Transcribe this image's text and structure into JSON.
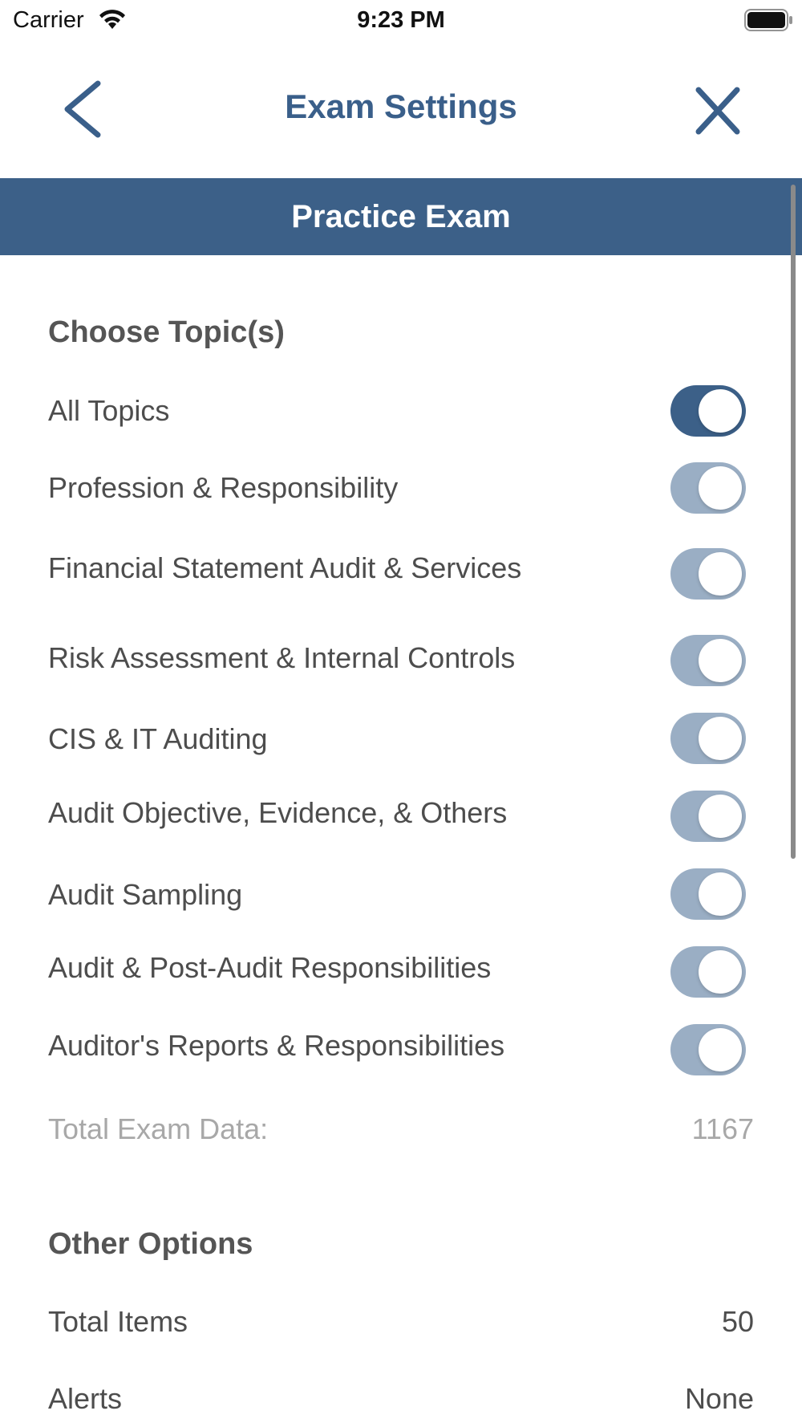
{
  "status_bar": {
    "carrier": "Carrier",
    "time": "9:23 PM",
    "icons": [
      "wifi-icon",
      "battery-icon"
    ]
  },
  "nav": {
    "title": "Exam Settings",
    "back_icon": "chevron-left-icon",
    "close_icon": "close-icon",
    "accent_color": "#3a5f8a"
  },
  "banner": {
    "title": "Practice Exam",
    "background_color": "#3c6088"
  },
  "topics": {
    "heading": "Choose Topic(s)",
    "items": [
      {
        "label": "All Topics",
        "on": true
      },
      {
        "label": "Profession & Responsibility",
        "on": true
      },
      {
        "label": "Financial Statement Audit & Services",
        "on": true
      },
      {
        "label": "Risk Assessment & Internal Controls",
        "on": true
      },
      {
        "label": "CIS & IT Auditing",
        "on": true
      },
      {
        "label": "Audit Objective, Evidence, & Others",
        "on": true
      },
      {
        "label": "Audit Sampling",
        "on": true
      },
      {
        "label": "Audit & Post-Audit Responsibilities",
        "on": true
      },
      {
        "label": "Auditor's Reports & Responsibilities",
        "on": true
      }
    ],
    "total_label": "Total Exam Data:",
    "total_value": "1167",
    "toggle_on_color": "#3c6088",
    "toggle_disabled_color": "#9aaec4"
  },
  "other_options": {
    "heading": "Other Options",
    "total_items_label": "Total Items",
    "total_items_value": "50",
    "alerts_label": "Alerts",
    "alerts_value": "None"
  }
}
